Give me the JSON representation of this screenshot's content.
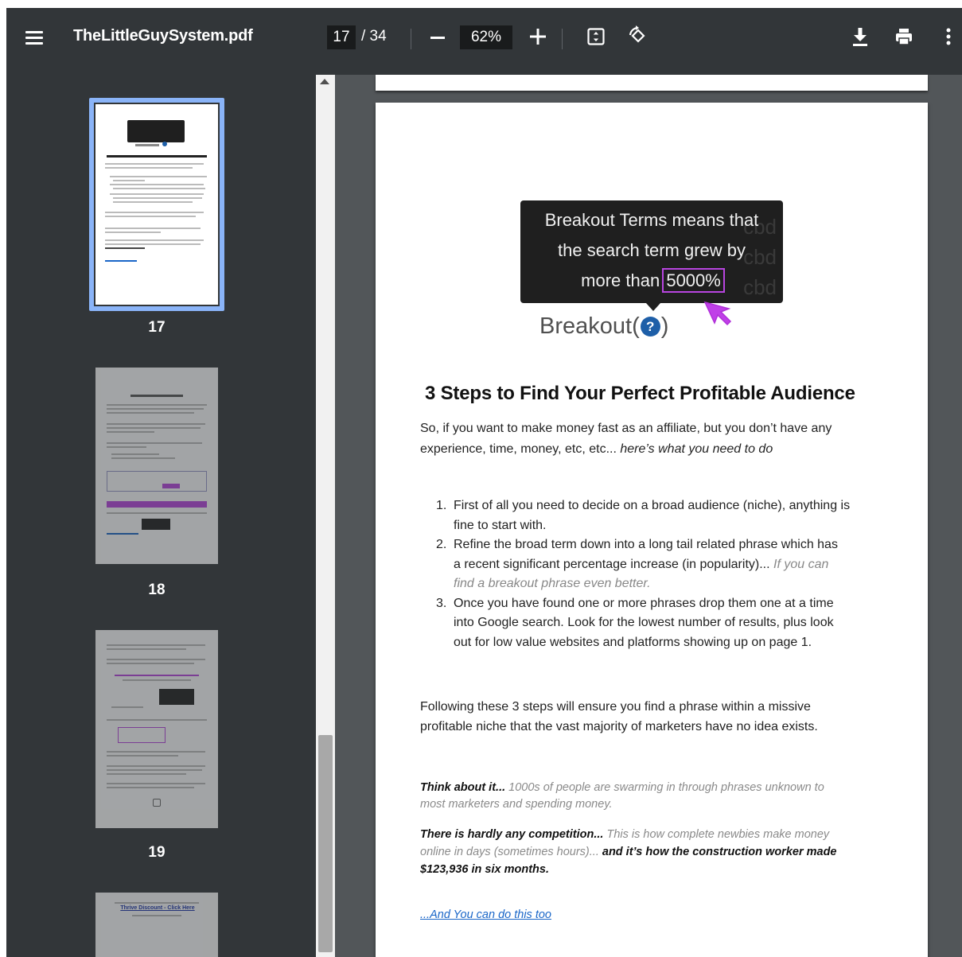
{
  "toolbar": {
    "title": "TheLittleGuySystem.pdf",
    "current_page": "17",
    "total_pages": "/ 34",
    "zoom": "62%"
  },
  "sidebar": {
    "thumbnails": [
      {
        "page": "17",
        "selected": true
      },
      {
        "page": "18",
        "selected": false
      },
      {
        "page": "19",
        "selected": false
      }
    ]
  },
  "page": {
    "tooltip": {
      "line1": "Breakout Terms means that",
      "line2": "the search term grew by",
      "line3_prefix": "more than",
      "line3_highlight": "5000%",
      "ghost": "cbd"
    },
    "breakout_label": "Breakout(",
    "breakout_close": ")",
    "breakout_icon": "?",
    "heading": "3 Steps to Find Your Perfect Profitable Audience",
    "intro_line1": "So, if you want to make money fast as an affiliate, but you don’t have any",
    "intro_line2_plain": "experience, time, money, etc, etc... ",
    "intro_line2_italic": "here’s what you need to do",
    "steps": [
      {
        "num": "1.",
        "lines": [
          "First of all you need to decide on a broad audience (niche), anything is",
          "fine to start with."
        ]
      },
      {
        "num": "2.",
        "lines": [
          "Refine the broad term down into a long tail related phrase which has",
          "a recent significant percentage increase (in popularity)... "
        ],
        "muted": [
          "If you can",
          "find a breakout phrase even better."
        ]
      },
      {
        "num": "3.",
        "lines": [
          "Once you have found one or more phrases drop them one at a time",
          "into Google search. Look for the lowest number of results, plus look",
          "out for low value websites and platforms showing up on page 1."
        ]
      }
    ],
    "following_line1": "Following these 3 steps will ensure you find a phrase within a missive",
    "following_line2": "profitable niche that the vast majority of marketers have no idea exists.",
    "think_bold": "Think about it...",
    "think_rest1": " 1000s of people are swarming in through phrases unknown to",
    "think_rest2": "most marketers and spending money.",
    "comp_bold": "There is hardly any competition...",
    "comp_rest1": " This is how complete newbies make money",
    "comp_rest2": "online in days (sometimes hours)... ",
    "comp_strong1": "and it’s how the construction worker made",
    "comp_strong2": "$123,936 in six months.",
    "link": "...And You can do this too"
  },
  "thumb19_link": "Thrive Discount - Click Here"
}
